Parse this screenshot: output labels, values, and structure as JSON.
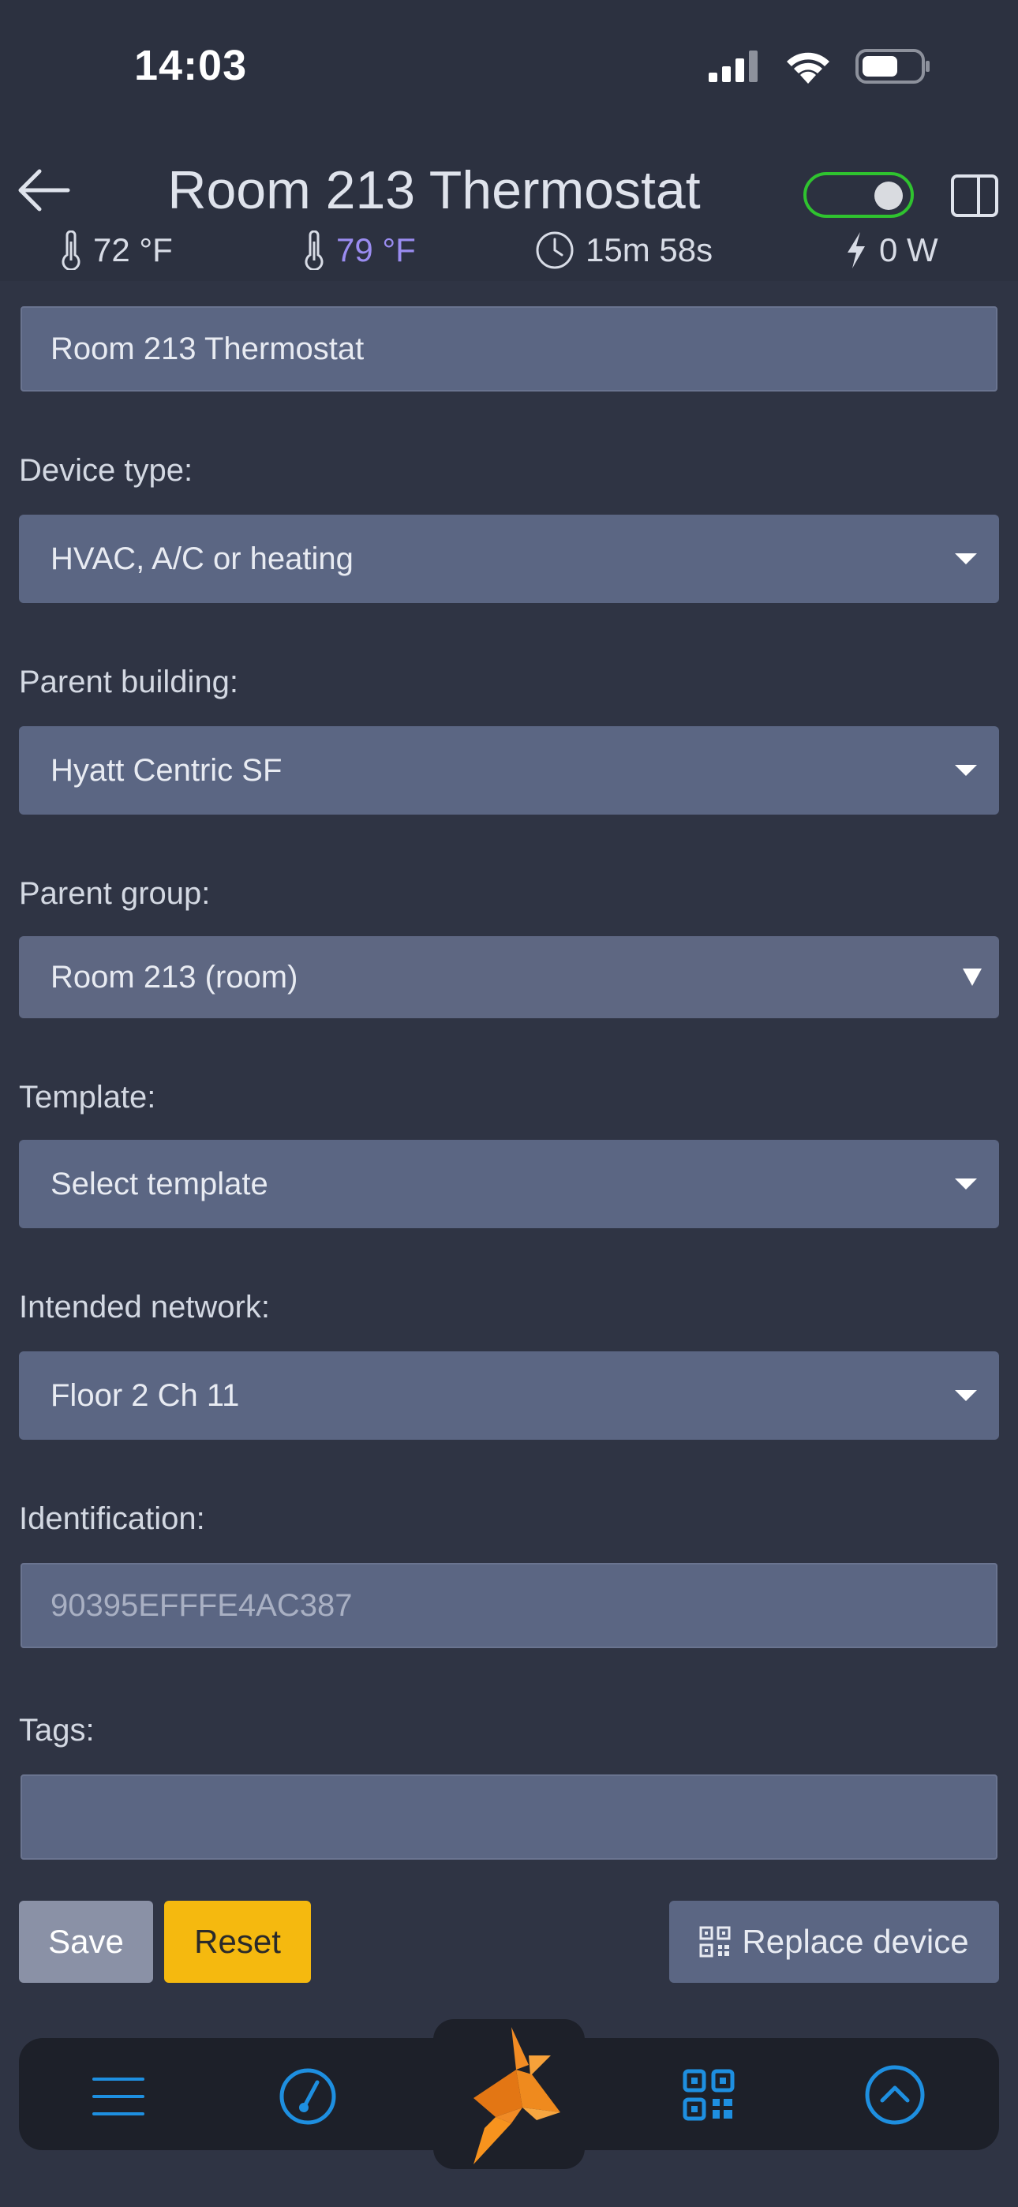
{
  "status_bar": {
    "time": "14:03"
  },
  "header": {
    "title": "Room 213 Thermostat",
    "enabled": true,
    "stats": {
      "temp_current": "72 °F",
      "temp_setpoint": "79 °F",
      "elapsed": "15m 58s",
      "power": "0 W"
    }
  },
  "form": {
    "name_value": "Room 213 Thermostat",
    "device_type": {
      "label": "Device type:",
      "value": "HVAC, A/C or heating"
    },
    "parent_building": {
      "label": "Parent building:",
      "value": "Hyatt Centric SF"
    },
    "parent_group": {
      "label": "Parent group:",
      "value": "Room 213 (room)"
    },
    "template": {
      "label": "Template:",
      "value": "Select template"
    },
    "intended_network": {
      "label": "Intended network:",
      "value": "Floor 2 Ch 11"
    },
    "identification": {
      "label": "Identification:",
      "placeholder": "90395EFFFE4AC387"
    },
    "tags": {
      "label": "Tags:",
      "value": ""
    }
  },
  "actions": {
    "save": "Save",
    "reset": "Reset",
    "replace": "Replace device"
  },
  "bottom_nav": {
    "items": [
      "menu-icon",
      "gauge-icon",
      "bird-logo",
      "qr-code-icon",
      "scroll-up-icon"
    ]
  },
  "colors": {
    "background": "#2f3444",
    "field": "#5b6683",
    "toggle_on": "#2fc32f",
    "reset_button": "#f5b90f",
    "accent_blue": "#1e8fe0",
    "setpoint_purple": "#9a8cf0"
  }
}
